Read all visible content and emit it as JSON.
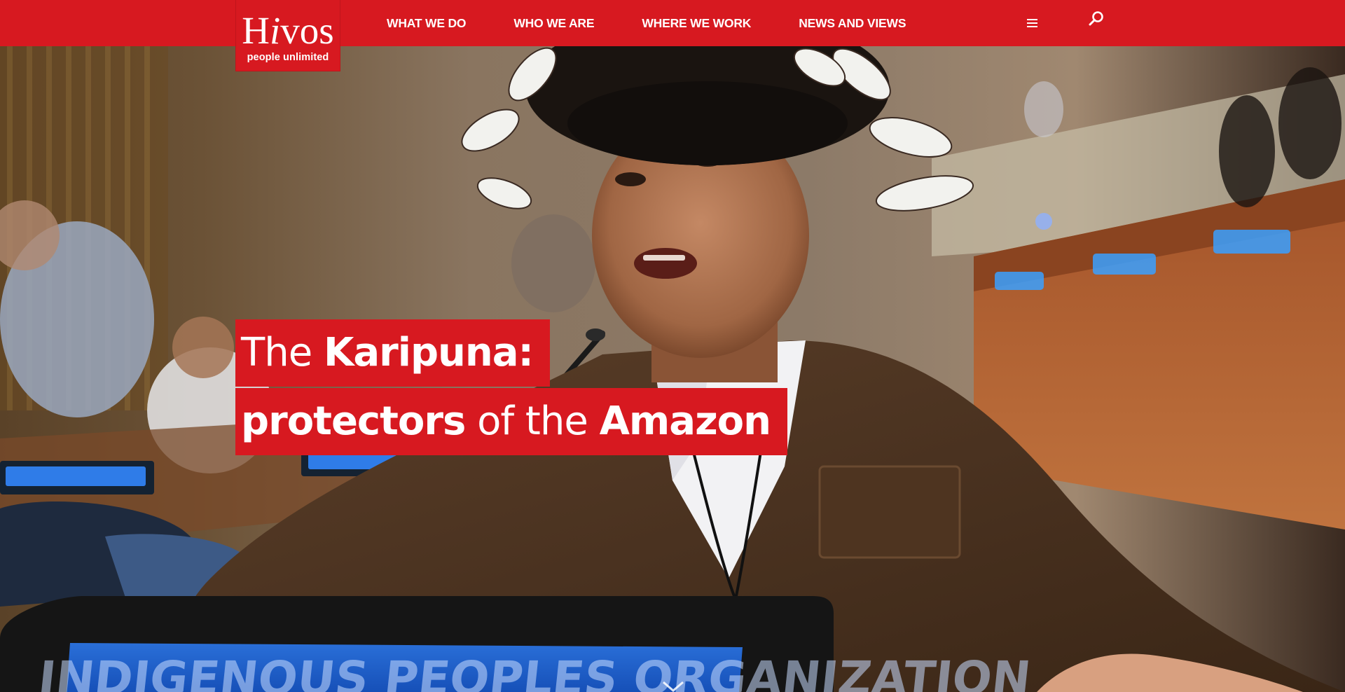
{
  "brand": {
    "logo_text_main": "Hivos",
    "logo_text_first": "H",
    "logo_text_italic": "i",
    "logo_text_rest": "vos",
    "logo_tagline": "people unlimited",
    "color": "#d71920"
  },
  "nav": {
    "items": [
      {
        "label": "WHAT WE DO"
      },
      {
        "label": "WHO WE ARE"
      },
      {
        "label": "WHERE WE WORK"
      },
      {
        "label": "NEWS AND VIEWS"
      }
    ],
    "menu_icon": "hamburger-menu-icon",
    "search_icon": "search-icon"
  },
  "hero": {
    "headline_line1_light": "The ",
    "headline_line1_bold": "Karipuna:",
    "headline_line2_bold_a": "protectors",
    "headline_line2_light": " of the ",
    "headline_line2_bold_b": "Amazon",
    "nameplate_text": "INDIGENOUS PEOPLES ORGANIZATION",
    "scroll_icon": "chevron-down-icon"
  }
}
